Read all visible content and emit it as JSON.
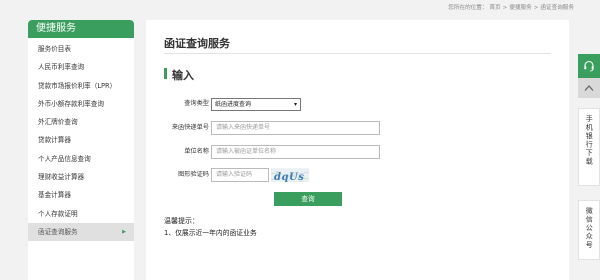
{
  "breadcrumb": {
    "prefix": "您所在的位置：",
    "items": [
      "首页",
      "便捷服务",
      "函证查询服务"
    ],
    "separator": ">"
  },
  "sidebar": {
    "title": "便捷服务",
    "items": [
      {
        "label": "服务价目表"
      },
      {
        "label": "人民币利率查询"
      },
      {
        "label": "贷款市场报价利率（LPR）"
      },
      {
        "label": "外币小额存款利率查询"
      },
      {
        "label": "外汇牌价查询"
      },
      {
        "label": "贷款计算器"
      },
      {
        "label": "个人产品信息查询"
      },
      {
        "label": "理财收益计算器"
      },
      {
        "label": "基金计算器"
      },
      {
        "label": "个人存款证明"
      },
      {
        "label": "函证查询服务",
        "active": true,
        "arrow": "▶"
      }
    ]
  },
  "main": {
    "page_title": "函证查询服务",
    "section_title": "输入",
    "form": {
      "query_type": {
        "label": "查询类型",
        "value": "纸函进度查询",
        "caret": "▾"
      },
      "tracking_no": {
        "label": "来函快递单号",
        "placeholder": "请输入来函快递单号"
      },
      "unit_name": {
        "label": "单位名称",
        "placeholder": "请输入被函证单位名称"
      },
      "captcha": {
        "label": "图形验证码",
        "placeholder": "请输入验证码",
        "image_text": "dqUs"
      }
    },
    "query_button": "查询",
    "tips": {
      "title": "温馨提示：",
      "lines": [
        "1、仅展示近一年内的函证业务"
      ]
    }
  },
  "float_bar": {
    "mobile_bank_label": "手机银行下载",
    "wechat_label": "微信公众号",
    "icons": [
      "headset-icon",
      "chevron-up-icon"
    ]
  },
  "colors": {
    "accent": "#3a9e5f",
    "background": "#f2f2f2"
  }
}
